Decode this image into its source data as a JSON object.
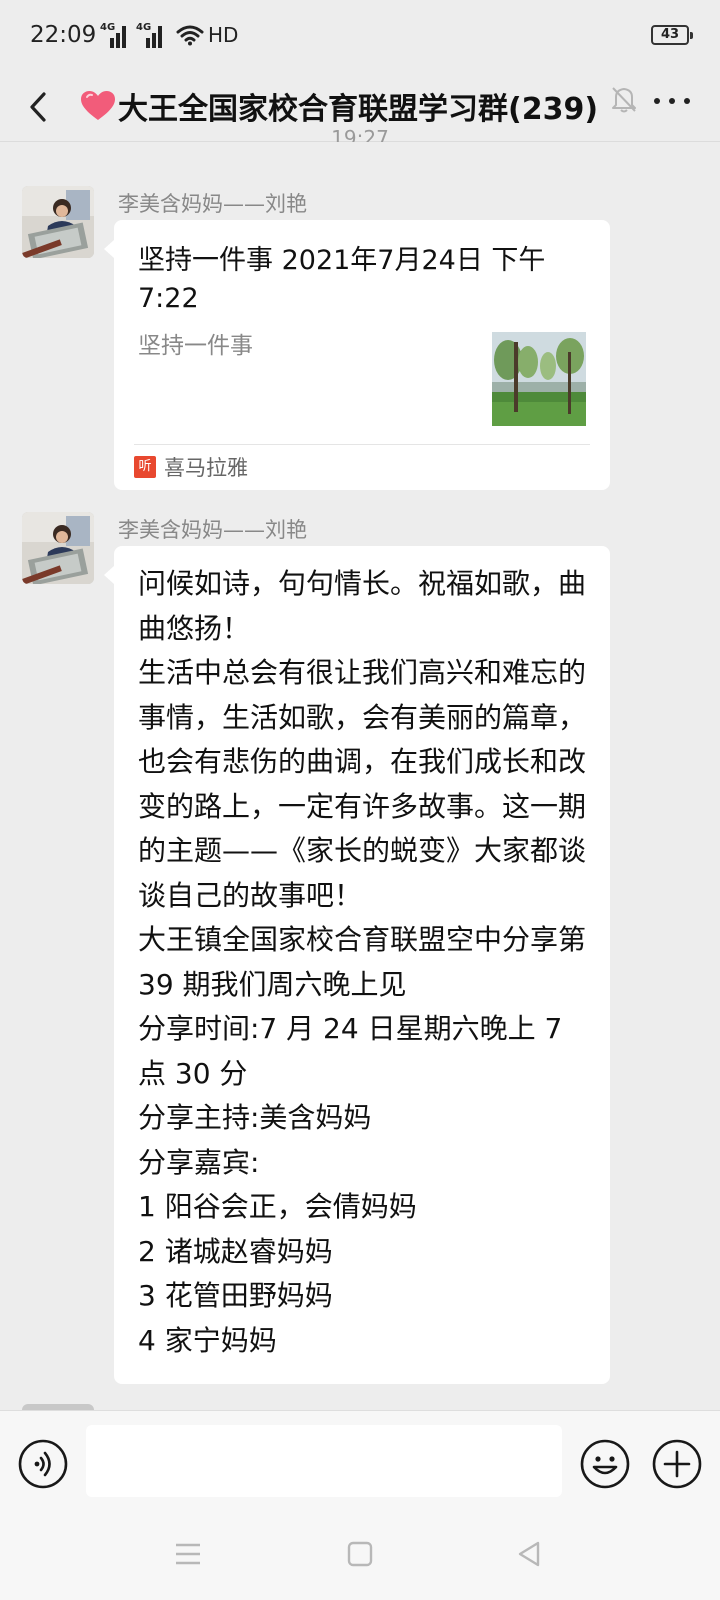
{
  "status_bar": {
    "time": "22:09",
    "signal1_label": "4G",
    "signal2_label": "4G",
    "wifi_icon": "wifi-icon",
    "hd_label": "HD",
    "battery_level": "43"
  },
  "nav": {
    "back_icon": "chevron-left-icon",
    "title": "大王全国家校合育联盟学习群(239)",
    "heart_icon": "heart-icon",
    "mute_icon": "bell-off-icon",
    "more_icon": "more-dots-icon"
  },
  "chat": {
    "time_divider": "19:27",
    "messages": [
      {
        "sender": "李美含妈妈——刘艳",
        "type": "link-card",
        "card": {
          "title": "坚持一件事 2021年7月24日 下午7:22",
          "description": "坚持一件事",
          "source": "喜马拉雅",
          "source_icon_text": "听"
        }
      },
      {
        "sender": "李美含妈妈——刘艳",
        "type": "text",
        "text": "问候如诗，句句情长。祝福如歌，曲曲悠扬！\n生活中总会有很让我们高兴和难忘的事情，生活如歌，会有美丽的篇章，也会有悲伤的曲调，在我们成长和改变的路上，一定有许多故事。这一期的主题——《家长的蜕变》大家都谈谈自己的故事吧！\n大王镇全国家校合育联盟空中分享第 39 期我们周六晚上见\n分享时间:7 月 24 日星期六晚上 7 点 30 分\n分享主持:美含妈妈\n分享嘉宾:\n1 阳谷会正，会倩妈妈\n2 诸城赵睿妈妈\n3 花管田野妈妈\n4 家宁妈妈"
      }
    ]
  },
  "input_bar": {
    "voice_icon": "voice-icon",
    "input_value": "",
    "emoji_icon": "emoji-icon",
    "plus_icon": "plus-icon"
  },
  "system_nav": {
    "menu_icon": "menu-icon",
    "home_icon": "home-square-icon",
    "back_icon": "back-triangle-icon"
  },
  "colors": {
    "background": "#ededed",
    "bubble": "#ffffff",
    "source_brand": "#e8482f"
  }
}
